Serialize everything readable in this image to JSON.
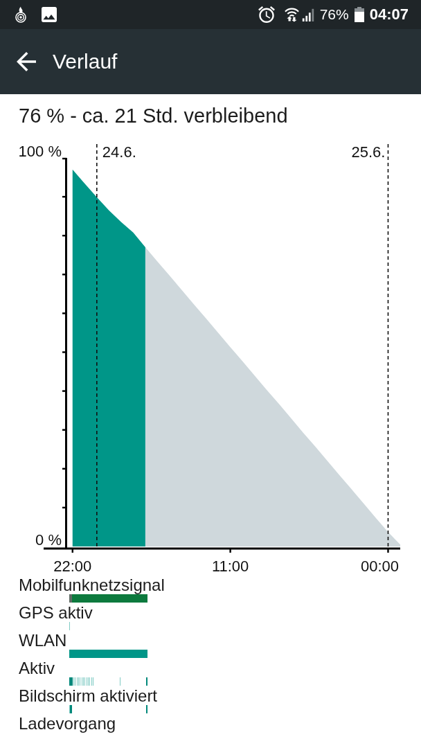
{
  "status_bar": {
    "battery_text": "76%",
    "time": "04:07"
  },
  "app_bar": {
    "title": "Verlauf"
  },
  "summary": "76 % - ca. 21 Std. verbleibend",
  "chart": {
    "chart_data": {
      "type": "area",
      "categories": [
        "22:00",
        null,
        null,
        null,
        null,
        null,
        null,
        null,
        null,
        null,
        null,
        null,
        null,
        "11:00",
        null,
        null,
        null,
        null,
        null,
        null,
        null,
        null,
        null,
        null,
        null,
        null,
        "00:00",
        null
      ],
      "series": [
        {
          "color": "#009688",
          "values": [
            97,
            93.4,
            89.9,
            86.5,
            83.5,
            80.8,
            77,
            null,
            null,
            null,
            null,
            null,
            null,
            null,
            null,
            null,
            null,
            null,
            null,
            null,
            null,
            null,
            null,
            null,
            null,
            null,
            null,
            null
          ]
        },
        {
          "color": "#cfd8dc",
          "values": [
            null,
            null,
            null,
            null,
            null,
            null,
            77,
            73.3,
            69.7,
            66,
            62.3,
            58.7,
            55,
            51.3,
            47.7,
            44,
            40.3,
            36.7,
            33,
            29.3,
            25.7,
            22,
            18.3,
            14.7,
            11,
            7.3,
            3.7,
            0.5
          ]
        }
      ],
      "ylim": [
        0,
        100
      ],
      "yticks": [
        {
          "value": 0,
          "label": "0 %"
        },
        {
          "value": 100,
          "label": "100 %"
        }
      ],
      "annotations": [
        "24.6.",
        "25.6."
      ]
    }
  },
  "timeline": [
    {
      "label": "Mobilfunknetzsignal"
    },
    {
      "label": "GPS aktiv"
    },
    {
      "label": "WLAN"
    },
    {
      "label": "Aktiv"
    },
    {
      "label": "Bildschirm aktiviert"
    },
    {
      "label": "Ladevorgang"
    }
  ]
}
